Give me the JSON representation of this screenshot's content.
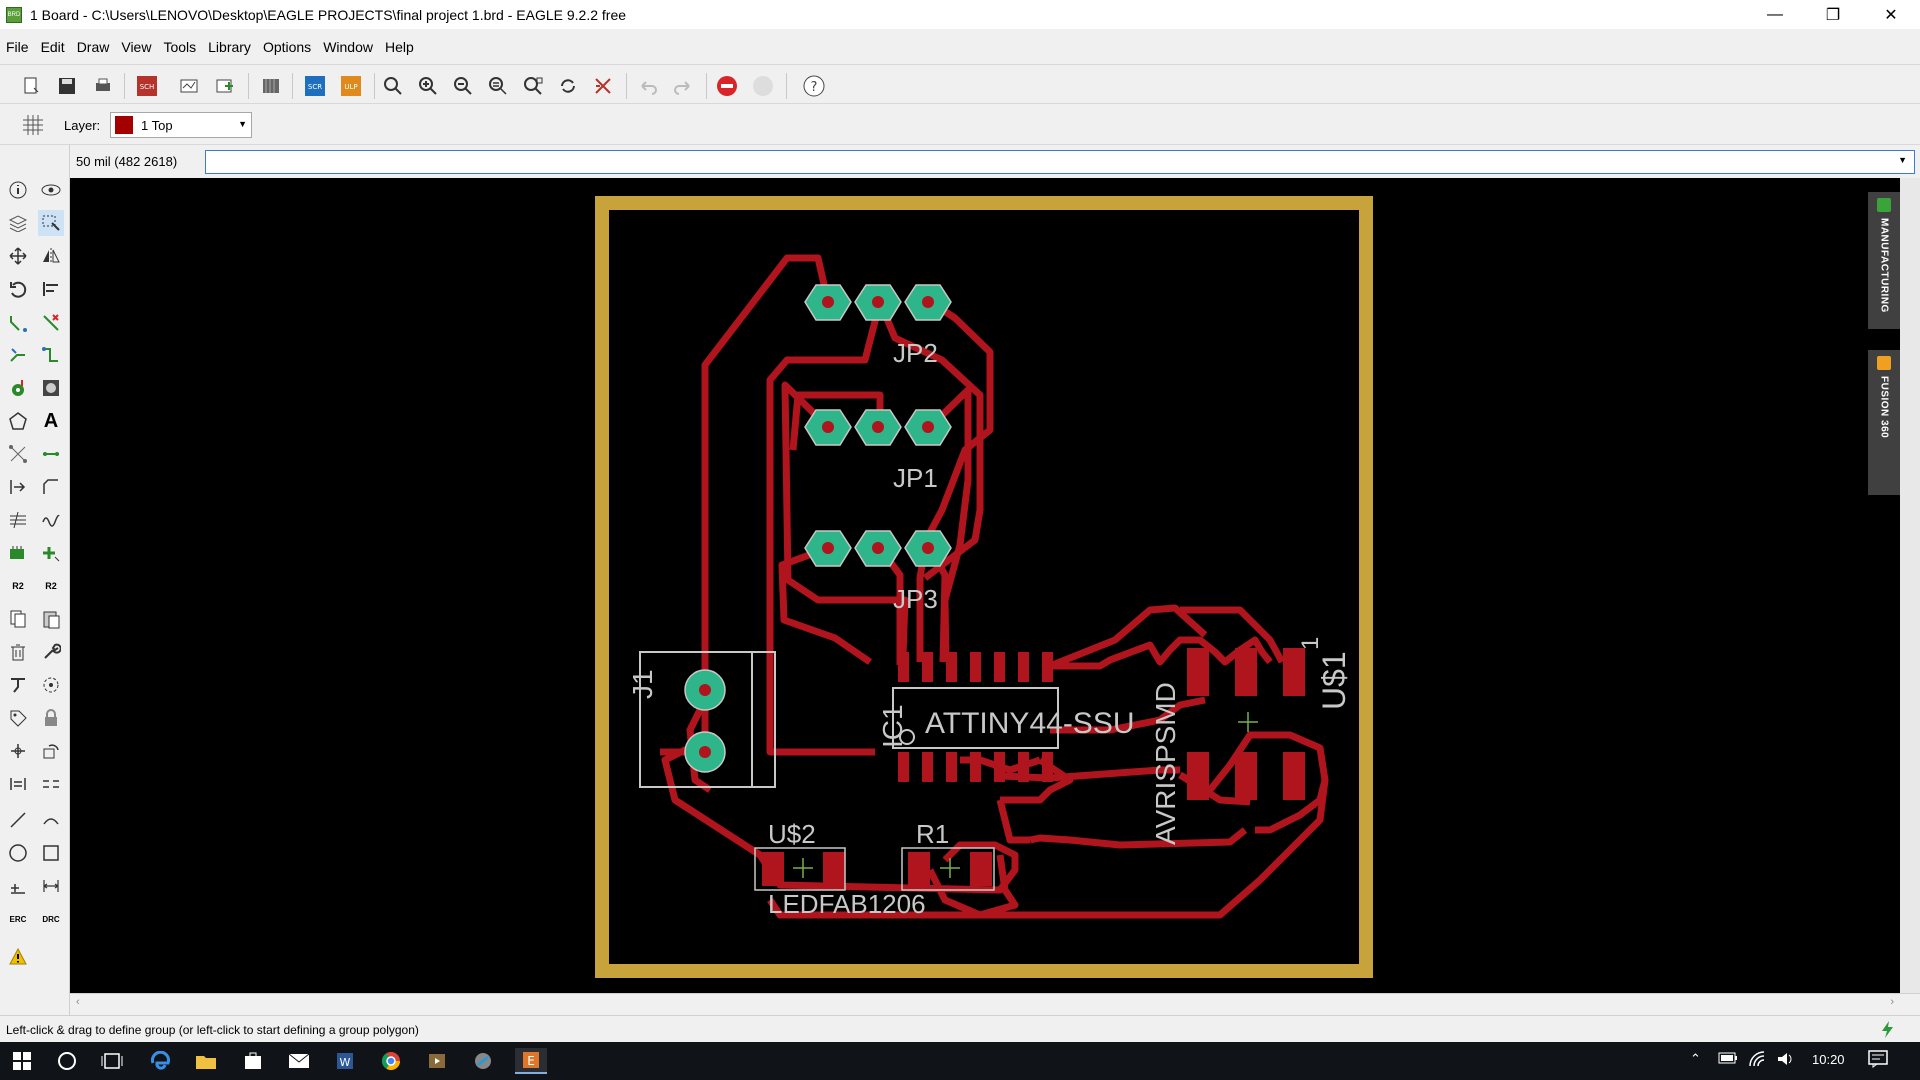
{
  "window": {
    "title": "1 Board - C:\\Users\\LENOVO\\Desktop\\EAGLE PROJECTS\\final project 1.brd - EAGLE 9.2.2 free",
    "app_icon_text": "BRD",
    "minimize": "—",
    "maximize": "❐",
    "close": "✕"
  },
  "menu": [
    "File",
    "Edit",
    "Draw",
    "View",
    "Tools",
    "Library",
    "Options",
    "Window",
    "Help"
  ],
  "toolbar": {
    "scr_label": "SCR",
    "ulp_label": "ULP",
    "sch_label": "SCH",
    "help_label": "?"
  },
  "layer": {
    "label": "Layer:",
    "selected": "1 Top",
    "color": "#a50000"
  },
  "command": {
    "coordinates": "50 mil (482 2618)",
    "value": ""
  },
  "side_tabs": {
    "manufacturing": "MANUFACTURING",
    "fusion": "FUSION 360"
  },
  "board": {
    "outline_color": "#c8a23a",
    "trace_color": "#b0141c",
    "pad_color": "#2fb58a",
    "text_color": "#c8c8c8",
    "labels": {
      "jp2": "JP2",
      "jp1": "JP1",
      "jp3": "JP3",
      "j1": "J1",
      "ic1": "IC1",
      "attiny": "ATTINY44-SSU",
      "avrisp": "AVRISPSMD",
      "us1": "U$1",
      "us1_pin": "1",
      "us2": "U$2",
      "r1": "R1",
      "ledfab": "LEDFAB1206"
    }
  },
  "status": {
    "message": "Left-click & drag to define group (or left-click to start defining a group polygon)"
  },
  "taskbar": {
    "clock": "10:20",
    "word_icon": "W",
    "eagle_icon": "E"
  }
}
